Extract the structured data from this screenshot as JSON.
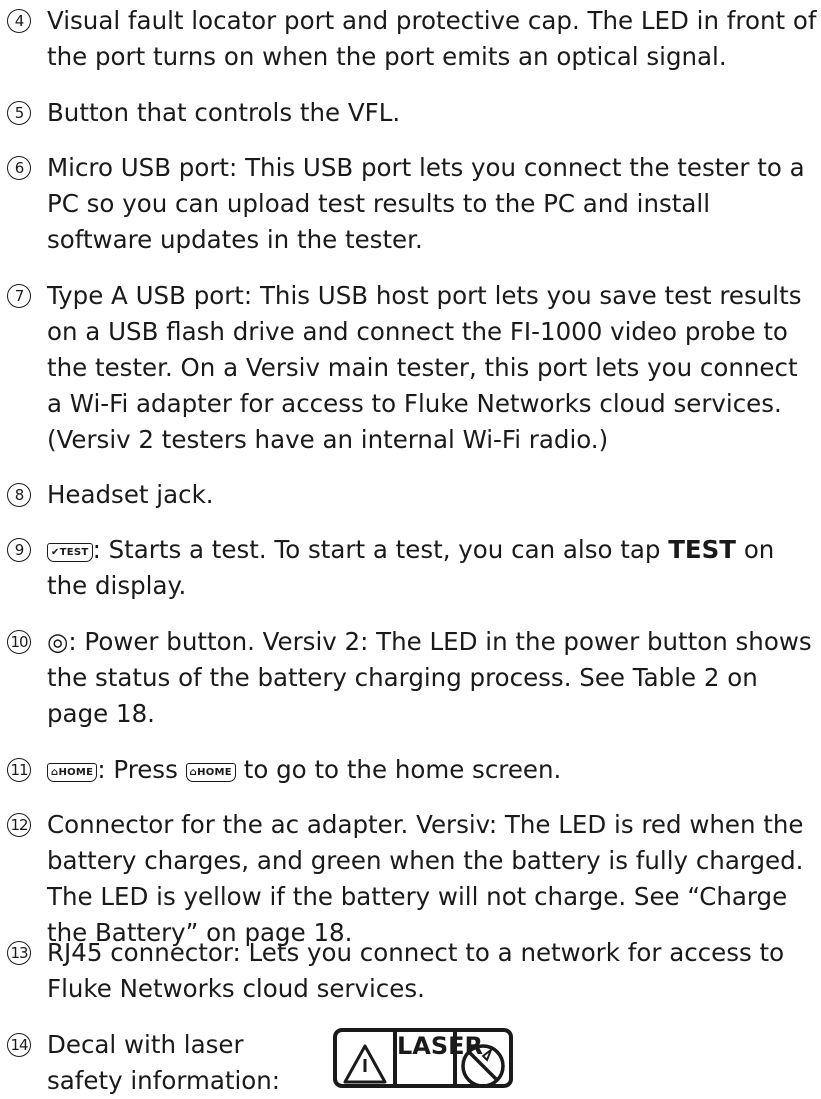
{
  "items": [
    {
      "num": "4",
      "text": "Visual fault locator port and protective cap. The LED in front of the port turns on when the port emits an optical signal."
    },
    {
      "num": "5",
      "text": "Button that controls the VFL."
    },
    {
      "num": "6",
      "text": "Micro USB port: This USB port lets you connect the tester to a PC so you can upload test results to the PC and install software updates in the tester."
    },
    {
      "num": "7",
      "text": "Type A USB port: This USB host port lets you save test results on a USB flash drive and connect the FI-1000 video probe to the tester. On a Versiv main tester, this port lets you connect a Wi-Fi adapter for access to Fluke Networks cloud services. (Versiv 2 testers have an internal Wi-Fi radio.)"
    },
    {
      "num": "8",
      "text": "Headset jack."
    },
    {
      "num": "9",
      "key": "✔TEST",
      "text_a": ": Starts a test. To start a test, you can also tap ",
      "bold": "TEST",
      "text_b": " on the display."
    },
    {
      "num": "10",
      "glyph": "◎",
      "text": ": Power button. Versiv 2: The LED in the power button shows the status of the battery charging process. See Table 2 on page 18."
    },
    {
      "num": "11",
      "key": "⌂HOME",
      "text_a": ": Press ",
      "text_b": " to go to the home screen."
    },
    {
      "num": "12",
      "text": "Connector for the ac adapter. Versiv: The LED is red when the battery charges, and green when the battery is fully charged. The LED is yellow if the battery will not charge. See “Charge the Battery” on page 18."
    },
    {
      "num": "13",
      "text": "RJ45 connector: Lets you connect to a network for access to Fluke Networks cloud services."
    },
    {
      "num": "14",
      "text": "Decal with laser safety information:"
    }
  ],
  "decal": {
    "laser_label": "LASER"
  },
  "icons": {
    "warning": "warning-triangle-icon",
    "no_view": "no-viewing-laser-icon"
  }
}
